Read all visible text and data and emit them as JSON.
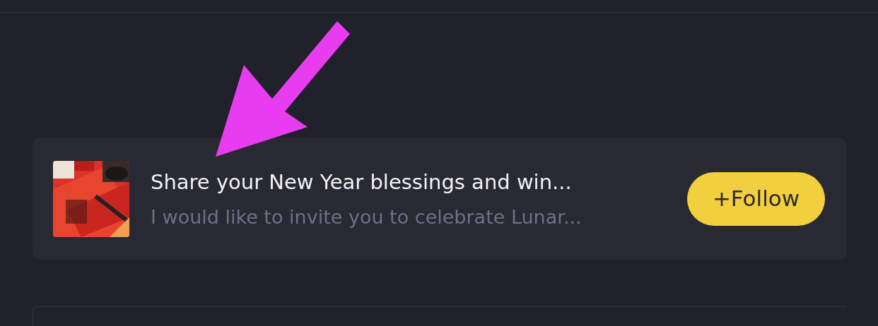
{
  "post_card": {
    "title": "Share your New Year blessings and win...",
    "excerpt": "I would like to invite you to celebrate Lunar...",
    "follow_button": "+Follow"
  }
}
